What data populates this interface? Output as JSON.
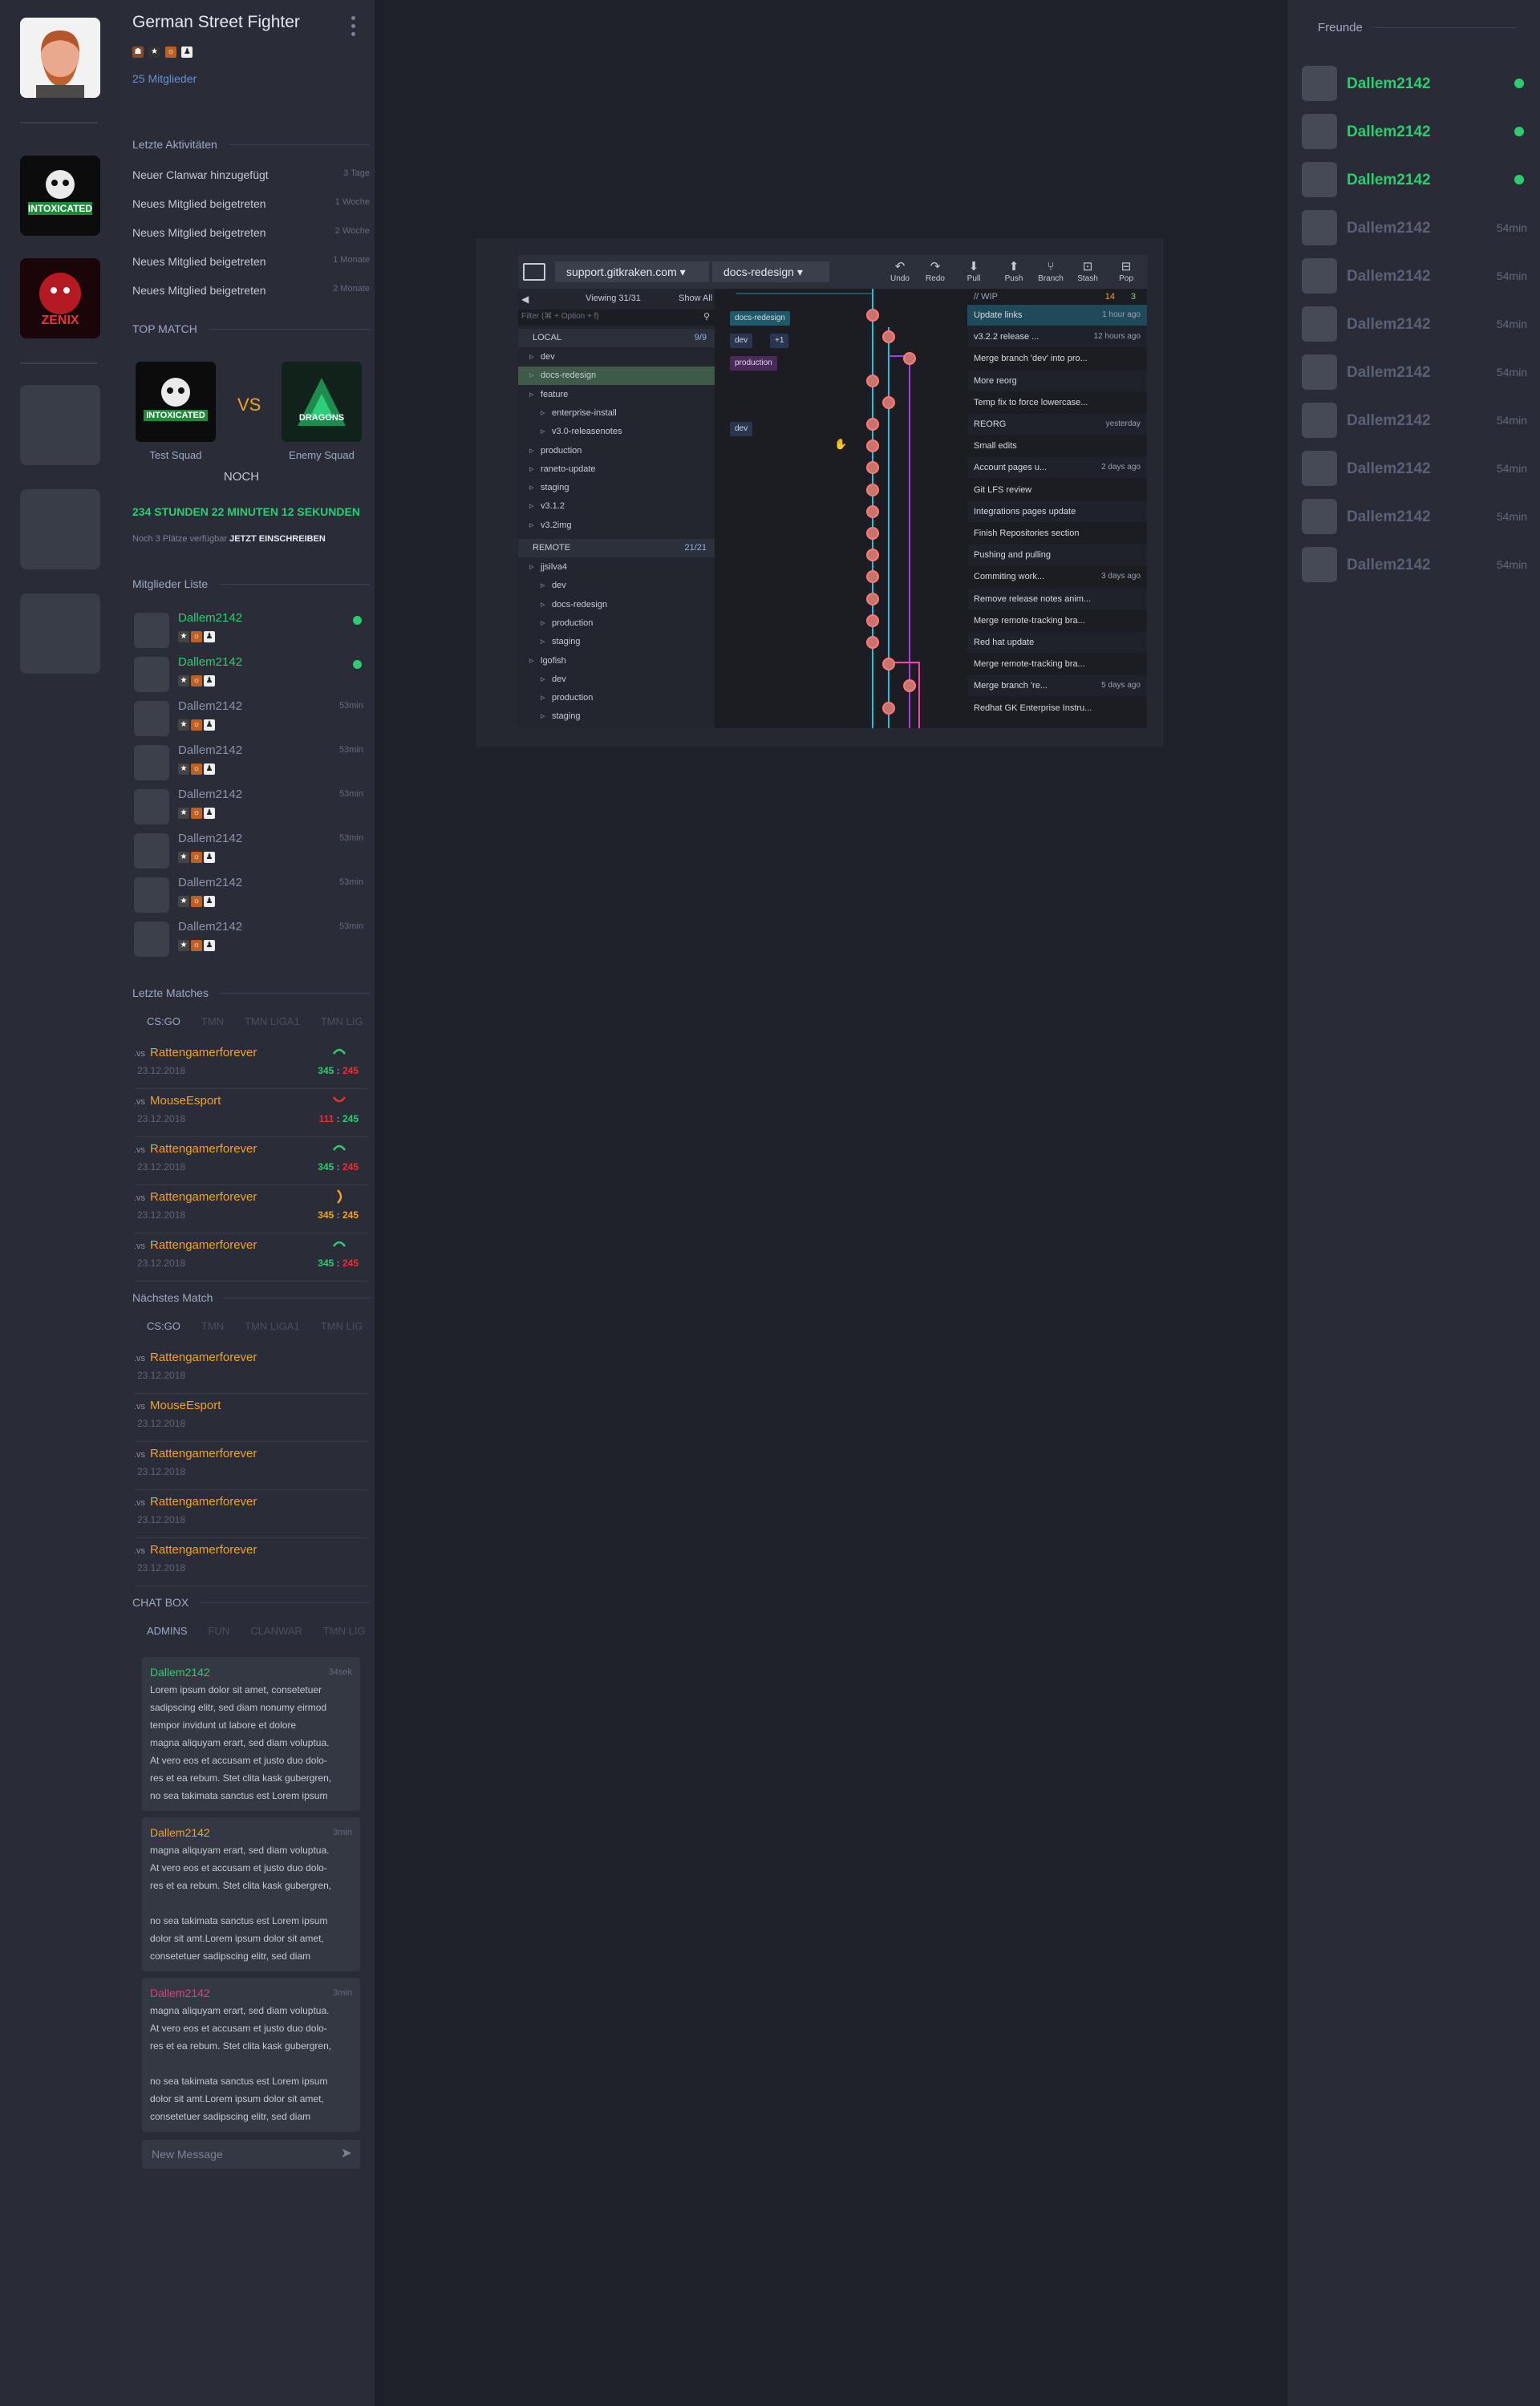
{
  "sidebar_rail": {
    "avatars": [
      "profile",
      "intoxicated-clan",
      "zenix-clan"
    ]
  },
  "clan": {
    "name": "German Street Fighter",
    "members": "25 Mitglieder"
  },
  "activities": {
    "title": "Letzte Aktivitäten",
    "items": [
      {
        "text": "Neuer Clanwar hinzugefügt",
        "time": "3 Tage"
      },
      {
        "text": "Neues Mitglied beigetreten",
        "time": "1 Woche"
      },
      {
        "text": "Neues Mitglied beigetreten",
        "time": "2 Woche"
      },
      {
        "text": "Neues Mitglied beigetreten",
        "time": "1 Monate"
      },
      {
        "text": "Neues Mitglied beigetreten",
        "time": "2 Monate"
      }
    ]
  },
  "top_match": {
    "title": "TOP MATCH",
    "home": "Test Squad",
    "away": "Enemy Squad",
    "home_logo": "INTOXICATED",
    "away_logo": "DRAGONS",
    "vs": "VS",
    "noch": "NOCH",
    "countdown": "234 STUNDEN 22 MINUTEN 12 SEKUNDEN",
    "slots": "Noch 3 Plätze verfügbar",
    "signup": "JETZT EINSCHREIBEN"
  },
  "members": {
    "title": "Mitglieder Liste",
    "items": [
      {
        "name": "Dallem2142",
        "status": "online"
      },
      {
        "name": "Dallem2142",
        "status": "online"
      },
      {
        "name": "Dallem2142",
        "status": "53min"
      },
      {
        "name": "Dallem2142",
        "status": "53min"
      },
      {
        "name": "Dallem2142",
        "status": "53min"
      },
      {
        "name": "Dallem2142",
        "status": "53min"
      },
      {
        "name": "Dallem2142",
        "status": "53min"
      },
      {
        "name": "Dallem2142",
        "status": "53min"
      }
    ]
  },
  "last_matches": {
    "title": "Letzte Matches",
    "tabs": [
      "CS:GO",
      "TMN",
      "TMN LIGA1",
      "TMN LIG"
    ],
    "items": [
      {
        "vs": ".vs",
        "team": "Rattengamerforever",
        "date": "23.12.2018",
        "a": "345",
        "b": "245",
        "result": "win"
      },
      {
        "vs": ".vs",
        "team": "MouseEsport",
        "date": "23.12.2018",
        "a": "111",
        "b": "245",
        "result": "loss"
      },
      {
        "vs": ".vs",
        "team": "Rattengamerforever",
        "date": "23.12.2018",
        "a": "345",
        "b": "245",
        "result": "win"
      },
      {
        "vs": ".vs",
        "team": "Rattengamerforever",
        "date": "23.12.2018",
        "a": "345",
        "b": "245",
        "result": "draw"
      },
      {
        "vs": ".vs",
        "team": "Rattengamerforever",
        "date": "23.12.2018",
        "a": "345",
        "b": "245",
        "result": "win"
      }
    ]
  },
  "next_match": {
    "title": "Nächstes Match",
    "tabs": [
      "CS:GO",
      "TMN",
      "TMN LIGA1",
      "TMN LIG"
    ],
    "items": [
      {
        "vs": ".vs",
        "team": "Rattengamerforever",
        "date": "23.12.2018"
      },
      {
        "vs": ".vs",
        "team": "MouseEsport",
        "date": "23.12.2018"
      },
      {
        "vs": ".vs",
        "team": "Rattengamerforever",
        "date": "23.12.2018"
      },
      {
        "vs": ".vs",
        "team": "Rattengamerforever",
        "date": "23.12.2018"
      },
      {
        "vs": ".vs",
        "team": "Rattengamerforever",
        "date": "23.12.2018"
      }
    ]
  },
  "chat": {
    "title": "CHAT BOX",
    "tabs": [
      "ADMINS",
      "FUN",
      "CLANWAR",
      "TMN LIG"
    ],
    "placeholder": "New Message",
    "messages": [
      {
        "name": "Dallem2142",
        "time": "34sek",
        "color": "#2ecc71",
        "lines": [
          "Lorem ipsum dolor sit amet, consetetuer",
          "sadipscing elitr, sed diam nonumy eirmod",
          "tempor invidunt ut labore et dolore",
          "magna aliquyam erart, sed diam voluptua.",
          "At vero eos et accusam et justo duo dolo-",
          "res et ea rebum. Stet clita kask gubergren,",
          "no sea takimata sanctus est Lorem ipsum"
        ]
      },
      {
        "name": "Dallem2142",
        "time": "3min",
        "color": "#f0a22c",
        "lines": [
          "magna aliquyam erart, sed diam voluptua.",
          "At vero eos et accusam et justo duo dolo-",
          "res et ea rebum. Stet clita kask gubergren,",
          "",
          "no sea takimata sanctus est Lorem ipsum",
          "dolor sit amt.Lorem ipsum dolor sit amet,",
          "consetetuer sadipscing elitr, sed diam"
        ]
      },
      {
        "name": "Dallem2142",
        "time": "3min",
        "color": "#e0407a",
        "lines": [
          "magna aliquyam erart, sed diam voluptua.",
          "At vero eos et accusam et justo duo dolo-",
          "res et ea rebum. Stet clita kask gubergren,",
          "",
          "no sea takimata sanctus est Lorem ipsum",
          "dolor sit amt.Lorem ipsum dolor sit amet,",
          "consetetuer sadipscing elitr, sed diam"
        ]
      }
    ]
  },
  "friends": {
    "title": "Freunde",
    "items": [
      {
        "name": "Dallem2142",
        "status": "online"
      },
      {
        "name": "Dallem2142",
        "status": "online"
      },
      {
        "name": "Dallem2142",
        "status": "online"
      },
      {
        "name": "Dallem2142",
        "status": "54min"
      },
      {
        "name": "Dallem2142",
        "status": "54min"
      },
      {
        "name": "Dallem2142",
        "status": "54min"
      },
      {
        "name": "Dallem2142",
        "status": "54min"
      },
      {
        "name": "Dallem2142",
        "status": "54min"
      },
      {
        "name": "Dallem2142",
        "status": "54min"
      },
      {
        "name": "Dallem2142",
        "status": "54min"
      },
      {
        "name": "Dallem2142",
        "status": "54min"
      }
    ]
  },
  "gitkraken": {
    "repo": "support.gitkraken.com",
    "branch": "docs-redesign",
    "toolbar": [
      "Undo",
      "Redo",
      "Pull",
      "Push",
      "Branch",
      "Stash",
      "Pop"
    ],
    "viewing": "Viewing 31/31",
    "show_all": "Show All",
    "filter": "Filter (⌘ + Option + f)",
    "local_label": "LOCAL",
    "local_count": "9/9",
    "remote_label": "REMOTE",
    "remote_count": "21/21",
    "wip": "// WIP",
    "wip_a": "14",
    "wip_b": "3",
    "tree": [
      {
        "label": "dev",
        "ind": 1
      },
      {
        "label": "docs-redesign",
        "ind": 1,
        "sel": true
      },
      {
        "label": "feature",
        "ind": 1
      },
      {
        "label": "enterprise-install",
        "ind": 2
      },
      {
        "label": "v3.0-releasenotes",
        "ind": 2
      },
      {
        "label": "production",
        "ind": 1
      },
      {
        "label": "raneto-update",
        "ind": 1
      },
      {
        "label": "staging",
        "ind": 1
      },
      {
        "label": "v3.1.2",
        "ind": 1
      },
      {
        "label": "v3.2img",
        "ind": 1
      }
    ],
    "remote_tree": [
      {
        "label": "jjsilva4",
        "ind": 1
      },
      {
        "label": "dev",
        "ind": 2
      },
      {
        "label": "docs-redesign",
        "ind": 2
      },
      {
        "label": "production",
        "ind": 2
      },
      {
        "label": "staging",
        "ind": 2
      },
      {
        "label": "lgofish",
        "ind": 1
      },
      {
        "label": "dev",
        "ind": 2
      },
      {
        "label": "production",
        "ind": 2
      },
      {
        "label": "staging",
        "ind": 2
      }
    ],
    "refs": [
      {
        "label": "docs-redesign"
      },
      {
        "label": "dev"
      },
      {
        "label": "+1"
      },
      {
        "label": "production"
      },
      {
        "label": "dev"
      }
    ],
    "commits": [
      {
        "msg": "Update links",
        "time": "1 hour ago"
      },
      {
        "msg": "v3.2.2 release ...",
        "time": "12 hours ago"
      },
      {
        "msg": "Merge branch 'dev' into pro...",
        "time": ""
      },
      {
        "msg": "More reorg",
        "time": ""
      },
      {
        "msg": "Temp fix to force lowercase...",
        "time": ""
      },
      {
        "msg": "REORG",
        "time": "yesterday"
      },
      {
        "msg": "Small edits",
        "time": ""
      },
      {
        "msg": "Account pages u...",
        "time": "2 days ago"
      },
      {
        "msg": "Git LFS review",
        "time": ""
      },
      {
        "msg": "Integrations pages update",
        "time": ""
      },
      {
        "msg": "Finish Repositories section",
        "time": ""
      },
      {
        "msg": "Pushing and pulling",
        "time": ""
      },
      {
        "msg": "Commiting work...",
        "time": "3 days ago"
      },
      {
        "msg": "Remove release notes anim...",
        "time": ""
      },
      {
        "msg": "Merge remote-tracking bra...",
        "time": ""
      },
      {
        "msg": "Red hat update",
        "time": ""
      },
      {
        "msg": "Merge remote-tracking bra...",
        "time": ""
      },
      {
        "msg": "Merge branch 're...",
        "time": "5 days ago"
      },
      {
        "msg": "Redhat GK Enterprise Instru...",
        "time": ""
      }
    ]
  }
}
